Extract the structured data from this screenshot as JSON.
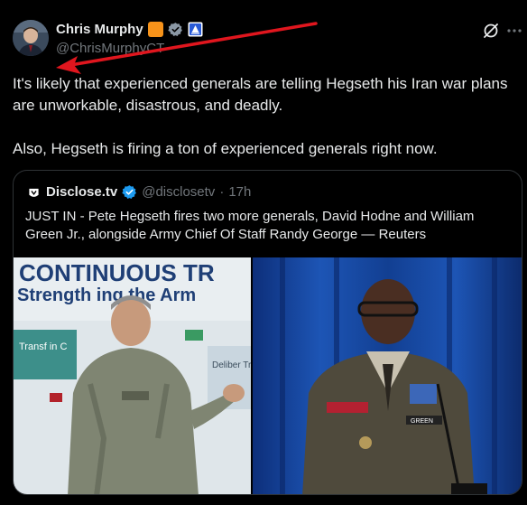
{
  "author": {
    "display_name": "Chris Murphy",
    "handle": "@ChrisMurphyCT",
    "verified_badge_color": "#1d9bf0",
    "flag_badge_color": "#f7931a"
  },
  "tweet": {
    "paragraphs": [
      "It's likely that experienced generals are telling Hegseth his Iran war plans are unworkable, disastrous, and deadly.",
      "Also, Hegseth is firing a ton of experienced generals right now."
    ]
  },
  "quote": {
    "display_name": "Disclose.tv",
    "handle": "@disclosetv",
    "separator": "·",
    "time": "17h",
    "text": "JUST IN - Pete Hegseth fires two more generals, David Hodne and William Green Jr., alongside Army Chief Of Staff Randy George — Reuters",
    "photo_left": {
      "banner_line1": "CONTINUOUS TR",
      "banner_line2": "Strength ing the Arm",
      "panel1": "Transf in C",
      "panel2": "Deliber Transfo"
    },
    "photo_right": {
      "nametag": "GREEN"
    }
  },
  "colors": {
    "background": "#000000",
    "text": "#e7e9ea",
    "muted": "#71767b",
    "border": "#2f3336",
    "annotation_arrow": "#e0161e"
  },
  "icons": [
    "avatar-photo",
    "flag-badge-icon",
    "verified-badge-icon",
    "affiliate-badge-icon",
    "grok-icon",
    "more-icon",
    "disclose-logo-icon"
  ]
}
